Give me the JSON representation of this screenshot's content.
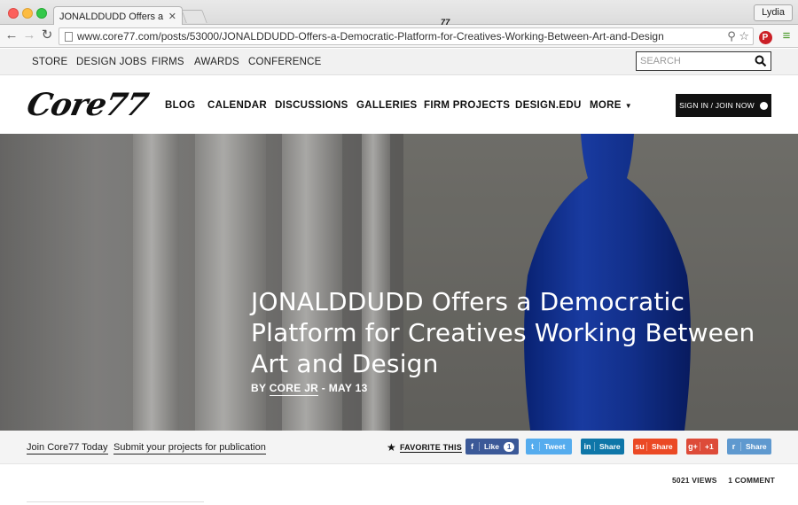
{
  "browser": {
    "tab_title": "JONALDDUDD Offers a De",
    "profile_name": "Lydia",
    "url": "www.core77.com/posts/53000/JONALDDUDD-Offers-a-Democratic-Platform-for-Creatives-Working-Between-Art-and-Design"
  },
  "utility_nav": {
    "items": [
      "STORE",
      "DESIGN JOBS",
      "FIRMS",
      "AWARDS",
      "CONFERENCE"
    ],
    "search_placeholder": "SEARCH"
  },
  "main_nav": {
    "logo": "Core77",
    "items": [
      "BLOG",
      "CALENDAR",
      "DISCUSSIONS",
      "GALLERIES",
      "FIRM PROJECTS",
      "DESIGN.EDU",
      "MORE"
    ],
    "signin_label": "SIGN IN / JOIN NOW"
  },
  "article": {
    "title": "JONALDDUDD Offers a Democratic Platform for Creatives Working Between Art and Design",
    "by_prefix": "BY",
    "author": "CORE JR",
    "date_sep": "-",
    "date": "MAY 13"
  },
  "share": {
    "join_link": "Join Core77 Today",
    "submit_link": "Submit your projects for publication",
    "favorite_label": "FAVORITE THIS",
    "buttons": [
      {
        "name": "facebook",
        "icon": "f",
        "label": "Like",
        "count": "1",
        "color": "#3b5998"
      },
      {
        "name": "twitter",
        "icon": "t",
        "label": "Tweet",
        "color": "#55acee"
      },
      {
        "name": "linkedin",
        "icon": "in",
        "label": "Share",
        "color": "#0e76a8"
      },
      {
        "name": "stumbleupon",
        "icon": "su",
        "label": "Share",
        "color": "#eb4924"
      },
      {
        "name": "googleplus",
        "icon": "g+",
        "label": "+1",
        "color": "#dd4b39"
      },
      {
        "name": "reddit",
        "icon": "r",
        "label": "Share",
        "color": "#5f99cf"
      }
    ]
  },
  "stats": {
    "views": "5021 VIEWS",
    "comments": "1 COMMENT"
  }
}
